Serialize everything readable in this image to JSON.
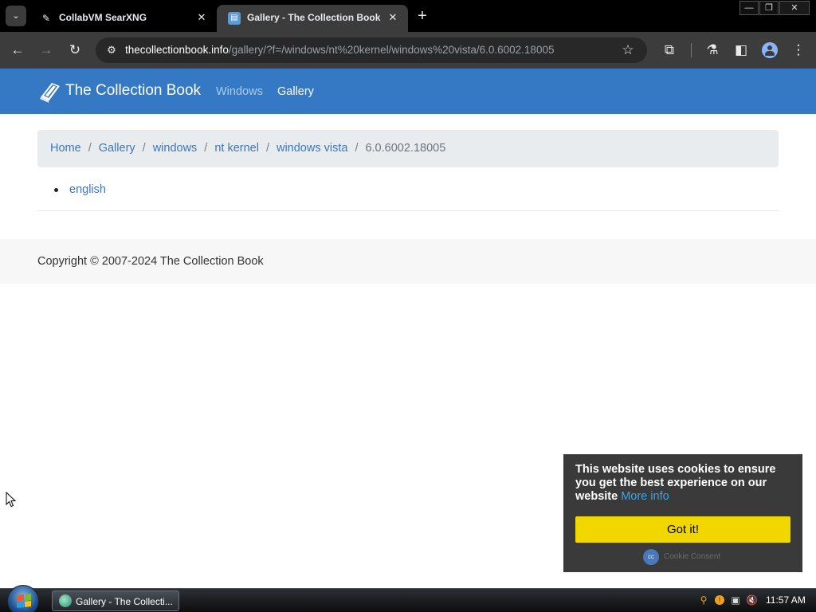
{
  "browser": {
    "tabs": [
      {
        "title": "CollabVM SearXNG",
        "favicon": "brush-icon",
        "close": "✕",
        "active": false
      },
      {
        "title": "Gallery - The Collection Book",
        "favicon": "book-icon",
        "close": "✕",
        "active": true
      }
    ],
    "tab_search_glyph": "⌄",
    "new_tab_glyph": "+",
    "window_controls": {
      "minimize": "—",
      "restore": "❐",
      "close": "✕"
    },
    "url": {
      "host": "thecollectionbook.info",
      "path": "/gallery/?f=/windows/nt%20kernel/windows%20vista/6.0.6002.18005"
    },
    "toolbar_glyphs": {
      "back": "←",
      "forward": "→",
      "reload": "↻",
      "site_info": "⚙",
      "bookmark": "☆",
      "extensions": "⧉",
      "labs": "⚗",
      "side_panel": "◧",
      "menu": "⋮"
    }
  },
  "site": {
    "brand": "The Collection Book",
    "nav": [
      {
        "label": "Windows",
        "active": false
      },
      {
        "label": "Gallery",
        "active": true
      }
    ],
    "accent_color": "#3579c4"
  },
  "breadcrumb": {
    "separator": "/",
    "items": [
      "Home",
      "Gallery",
      "windows",
      "nt kernel",
      "windows vista"
    ],
    "current": "6.0.6002.18005"
  },
  "listing": {
    "items": [
      "english"
    ]
  },
  "footer": {
    "copyright": "Copyright © 2007-2024 The Collection Book"
  },
  "cookie_banner": {
    "message": "This website uses cookies to ensure you get the best experience on our website",
    "more_info": "More info",
    "button": "Got it!",
    "logo_text": "Cookie Consent",
    "button_color": "#f1d600"
  },
  "taskbar": {
    "task_label": "Gallery - The Collecti...",
    "clock": "11:57 AM",
    "tray_icons": [
      "search-icon",
      "update-icon",
      "network-icon",
      "volume-muted-icon"
    ]
  }
}
